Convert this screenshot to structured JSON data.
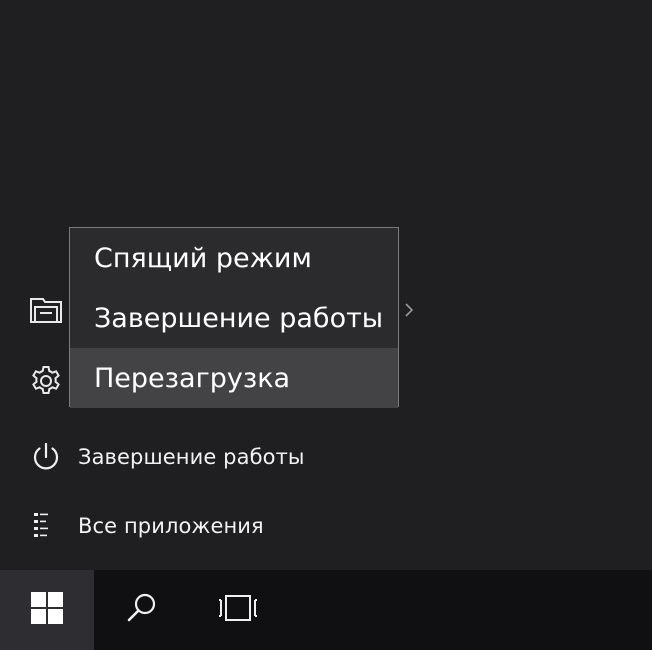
{
  "power_menu": {
    "items": [
      {
        "label": "Спящий режим",
        "highlighted": false
      },
      {
        "label": "Завершение работы",
        "highlighted": false
      },
      {
        "label": "Перезагрузка",
        "highlighted": true
      }
    ]
  },
  "sidebar": {
    "items": [
      {
        "icon": "file-explorer-icon",
        "label": ""
      },
      {
        "icon": "gear-icon",
        "label": ""
      },
      {
        "icon": "power-icon",
        "label": "Завершение работы"
      },
      {
        "icon": "all-apps-icon",
        "label": "Все приложения"
      }
    ]
  },
  "taskbar": {
    "buttons": [
      {
        "icon": "windows-logo-icon"
      },
      {
        "icon": "search-icon"
      },
      {
        "icon": "task-view-icon"
      }
    ]
  },
  "colors": {
    "background": "#1f1f22",
    "popup_background": "#2b2b2e",
    "popup_highlight": "#434346",
    "taskbar": "#101012",
    "start_button": "#2e2e32"
  }
}
